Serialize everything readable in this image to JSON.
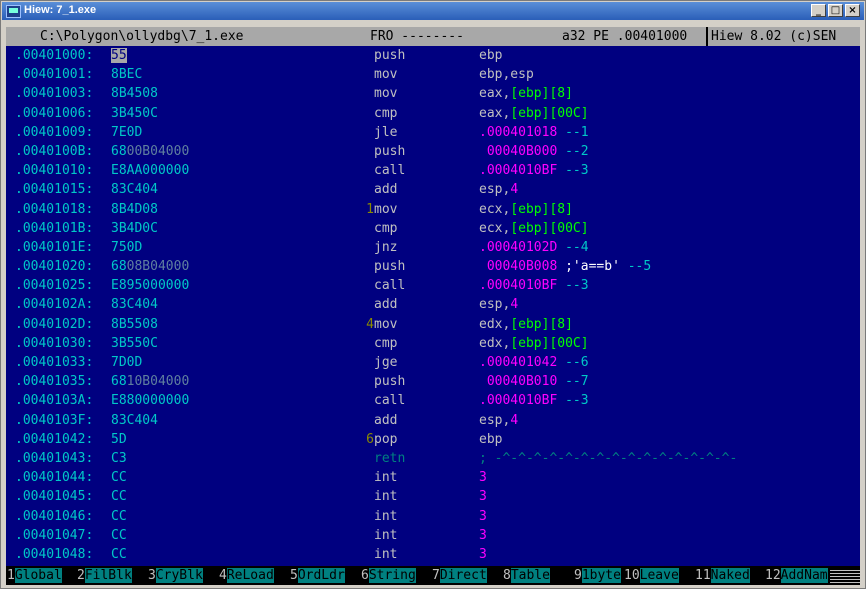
{
  "window": {
    "title": "Hiew: 7_1.exe",
    "buttons": [
      "_",
      "□",
      "×"
    ]
  },
  "status": {
    "path": "C:\\Polygon\\ollydbg\\7_1.exe",
    "mode": "⁠FRO --------",
    "info": "a32 PE .00401000",
    "version": "Hiew 8.02 (c)SEN"
  },
  "rows": [
    {
      "addr": ".00401000",
      "hex": [
        "",
        "55",
        ""
      ],
      "mark": "",
      "mn": "push",
      "op": [
        {
          "t": "ebp",
          "c": ""
        }
      ]
    },
    {
      "addr": ".00401001",
      "hex": [
        "8BEC",
        "",
        ""
      ],
      "mark": "",
      "mn": "mov",
      "op": [
        {
          "t": "ebp,esp",
          "c": ""
        }
      ]
    },
    {
      "addr": ".00401003",
      "hex": [
        "8B4508",
        "",
        ""
      ],
      "mark": "",
      "mn": "mov",
      "op": [
        {
          "t": "eax,",
          "c": ""
        },
        {
          "t": "[ebp][8]",
          "c": "grn"
        }
      ]
    },
    {
      "addr": ".00401006",
      "hex": [
        "3B450C",
        "",
        ""
      ],
      "mark": "",
      "mn": "cmp",
      "op": [
        {
          "t": "eax,",
          "c": ""
        },
        {
          "t": "[ebp][00C]",
          "c": "grn"
        }
      ]
    },
    {
      "addr": ".00401009",
      "hex": [
        "7E0D",
        "",
        ""
      ],
      "mark": "",
      "mn": "jle",
      "op": [
        {
          "t": ".000401018",
          "c": "mag"
        },
        {
          "t": " --⁠1",
          "c": "arrow"
        }
      ]
    },
    {
      "addr": ".0040100B",
      "hex": [
        "68",
        "",
        "00B04000"
      ],
      "mark": "",
      "mn": "push",
      "op": [
        {
          "t": " 00040B000",
          "c": "mag"
        },
        {
          "t": " --⁠2",
          "c": "arrow"
        }
      ]
    },
    {
      "addr": ".00401010",
      "hex": [
        "E8AA000000",
        "",
        ""
      ],
      "mark": "",
      "mn": "call",
      "op": [
        {
          "t": ".0004010BF",
          "c": "mag"
        },
        {
          "t": " --⁠3",
          "c": "arrow"
        }
      ]
    },
    {
      "addr": ".00401015",
      "hex": [
        "83C404",
        "",
        ""
      ],
      "mark": "",
      "mn": "add",
      "op": [
        {
          "t": "esp,",
          "c": ""
        },
        {
          "t": "4",
          "c": "mag"
        }
      ]
    },
    {
      "addr": ".00401018",
      "hex": [
        "8B4D08",
        "",
        ""
      ],
      "mark": "1",
      "mn": "mov",
      "op": [
        {
          "t": "ecx,",
          "c": ""
        },
        {
          "t": "[ebp][8]",
          "c": "grn"
        }
      ]
    },
    {
      "addr": ".0040101B",
      "hex": [
        "3B4D0C",
        "",
        ""
      ],
      "mark": "",
      "mn": "cmp",
      "op": [
        {
          "t": "ecx,",
          "c": ""
        },
        {
          "t": "[ebp][00C]",
          "c": "grn"
        }
      ]
    },
    {
      "addr": ".0040101E",
      "hex": [
        "750D",
        "",
        ""
      ],
      "mark": "",
      "mn": "jnz",
      "op": [
        {
          "t": ".00040102D",
          "c": "mag"
        },
        {
          "t": " --⁠4",
          "c": "arrow"
        }
      ]
    },
    {
      "addr": ".00401020",
      "hex": [
        "68",
        "",
        "08B04000"
      ],
      "mark": "",
      "mn": "push",
      "op": [
        {
          "t": " 00040B008",
          "c": "mag"
        },
        {
          "t": " ;'a==b'",
          "c": "wht"
        },
        {
          "t": " --⁠5",
          "c": "arrow"
        }
      ]
    },
    {
      "addr": ".00401025",
      "hex": [
        "E895000000",
        "",
        ""
      ],
      "mark": "",
      "mn": "call",
      "op": [
        {
          "t": ".0004010BF",
          "c": "mag"
        },
        {
          "t": " --⁠3",
          "c": "arrow"
        }
      ]
    },
    {
      "addr": ".0040102A",
      "hex": [
        "83C404",
        "",
        ""
      ],
      "mark": "",
      "mn": "add",
      "op": [
        {
          "t": "esp,",
          "c": ""
        },
        {
          "t": "4",
          "c": "mag"
        }
      ]
    },
    {
      "addr": ".0040102D",
      "hex": [
        "8B5508",
        "",
        ""
      ],
      "mark": "4",
      "mn": "mov",
      "op": [
        {
          "t": "edx,",
          "c": ""
        },
        {
          "t": "[ebp][8]",
          "c": "grn"
        }
      ]
    },
    {
      "addr": ".00401030",
      "hex": [
        "3B550C",
        "",
        ""
      ],
      "mark": "",
      "mn": "cmp",
      "op": [
        {
          "t": "edx,",
          "c": ""
        },
        {
          "t": "[ebp][00C]",
          "c": "grn"
        }
      ]
    },
    {
      "addr": ".00401033",
      "hex": [
        "7D0D",
        "",
        ""
      ],
      "mark": "",
      "mn": "jge",
      "op": [
        {
          "t": ".000401042",
          "c": "mag"
        },
        {
          "t": " --⁠6",
          "c": "arrow"
        }
      ]
    },
    {
      "addr": ".00401035",
      "hex": [
        "68",
        "",
        "10B04000"
      ],
      "mark": "",
      "mn": "push",
      "op": [
        {
          "t": " 00040B010",
          "c": "mag"
        },
        {
          "t": " --⁠7",
          "c": "arrow"
        }
      ]
    },
    {
      "addr": ".0040103A",
      "hex": [
        "E880000000",
        "",
        ""
      ],
      "mark": "",
      "mn": "call",
      "op": [
        {
          "t": ".0004010BF",
          "c": "mag"
        },
        {
          "t": " --⁠3",
          "c": "arrow"
        }
      ]
    },
    {
      "addr": ".0040103F",
      "hex": [
        "83C404",
        "",
        ""
      ],
      "mark": "",
      "mn": "add",
      "op": [
        {
          "t": "esp,",
          "c": ""
        },
        {
          "t": "4",
          "c": "mag"
        }
      ]
    },
    {
      "addr": ".00401042",
      "hex": [
        "5D",
        "",
        ""
      ],
      "mark": "6",
      "mn": "pop",
      "op": [
        {
          "t": "ebp",
          "c": ""
        }
      ]
    },
    {
      "addr": ".00401043",
      "hex": [
        "C3",
        "",
        ""
      ],
      "mark": "",
      "mn": "retn",
      "mnDim": true,
      "op": [
        {
          "t": "; -^-^-^-^-^-^-^-^-^-^-^-^-^-^-^-",
          "c": "dim"
        }
      ]
    },
    {
      "addr": ".00401044",
      "hex": [
        "CC",
        "",
        ""
      ],
      "mark": "",
      "mn": "int",
      "op": [
        {
          "t": "3",
          "c": "mag"
        }
      ]
    },
    {
      "addr": ".00401045",
      "hex": [
        "CC",
        "",
        ""
      ],
      "mark": "",
      "mn": "int",
      "op": [
        {
          "t": "3",
          "c": "mag"
        }
      ]
    },
    {
      "addr": ".00401046",
      "hex": [
        "CC",
        "",
        ""
      ],
      "mark": "",
      "mn": "int",
      "op": [
        {
          "t": "3",
          "c": "mag"
        }
      ]
    },
    {
      "addr": ".00401047",
      "hex": [
        "CC",
        "",
        ""
      ],
      "mark": "",
      "mn": "int",
      "op": [
        {
          "t": "3",
          "c": "mag"
        }
      ]
    },
    {
      "addr": ".00401048",
      "hex": [
        "CC",
        "",
        ""
      ],
      "mark": "",
      "mn": "int",
      "op": [
        {
          "t": "3",
          "c": "mag"
        }
      ]
    }
  ],
  "fkeys": [
    {
      "num": "1",
      "label": "Global"
    },
    {
      "num": "2",
      "label": "FilBlk"
    },
    {
      "num": "3",
      "label": "CryBlk"
    },
    {
      "num": "4",
      "label": "ReLoad"
    },
    {
      "num": "5",
      "label": "OrdLdr"
    },
    {
      "num": "6",
      "label": "String"
    },
    {
      "num": "7",
      "label": "Direct"
    },
    {
      "num": "8",
      "label": "Table"
    },
    {
      "num": "9",
      "label": "1byte"
    },
    {
      "num": "10",
      "label": "Leave"
    },
    {
      "num": "11",
      "label": "Naked"
    },
    {
      "num": "12",
      "label": "AddNam"
    }
  ]
}
